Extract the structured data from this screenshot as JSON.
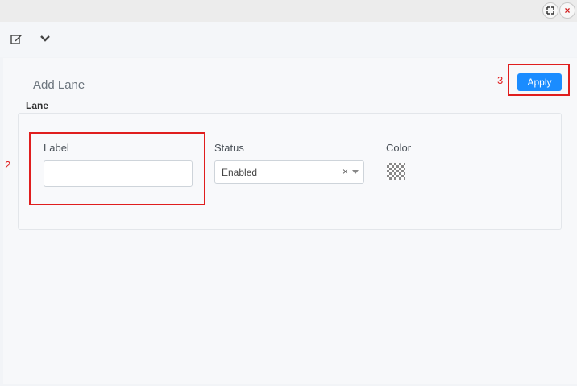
{
  "window": {
    "fullscreen_icon": "fullscreen-icon",
    "close_icon": "close-icon"
  },
  "toolbar": {
    "edit_icon": "edit-icon",
    "chevron_icon": "chevron-down-icon"
  },
  "panel": {
    "title": "Add Lane",
    "apply_label": "Apply",
    "section_label": "Lane"
  },
  "form": {
    "label_field": {
      "label": "Label",
      "value": ""
    },
    "status_field": {
      "label": "Status",
      "value": "Enabled",
      "clear": "×"
    },
    "color_field": {
      "label": "Color"
    }
  },
  "annotations": {
    "marker_2": "2",
    "marker_3": "3"
  },
  "colors": {
    "accent": "#1a8cff",
    "annotation": "#e01e1e"
  }
}
